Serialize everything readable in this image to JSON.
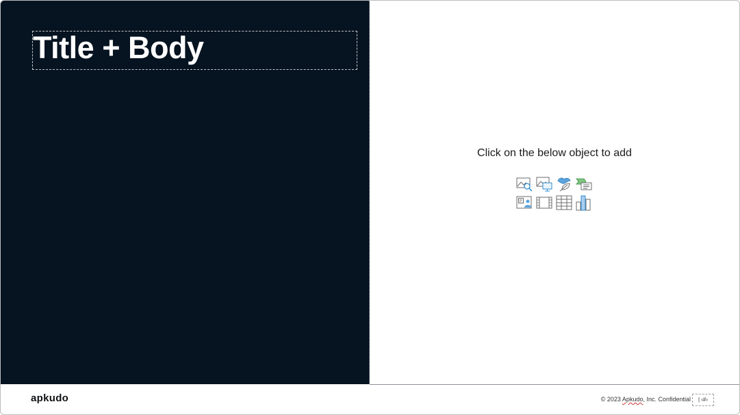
{
  "slide": {
    "title": "Title + Body",
    "placeholder_prompt": "Click on the below object to add",
    "insert_icons": [
      {
        "name": "search-image-icon",
        "label": "Search image"
      },
      {
        "name": "stock-image-icon",
        "label": "Stock images"
      },
      {
        "name": "icons-icon",
        "label": "Icons"
      },
      {
        "name": "smartart-icon",
        "label": "SmartArt"
      },
      {
        "name": "picture-icon",
        "label": "Pictures"
      },
      {
        "name": "video-icon",
        "label": "Video"
      },
      {
        "name": "table-icon",
        "label": "Table"
      },
      {
        "name": "chart-icon",
        "label": "Chart"
      }
    ]
  },
  "footer": {
    "logo_text": "apkudo",
    "copyright_prefix": "© 2023 ",
    "copyright_company": "Apkudo",
    "copyright_suffix": ", Inc. Confidential",
    "slide_number": "| ‹#›"
  },
  "colors": {
    "dark_panel": "#061320",
    "title_text": "#ffffff",
    "background": "#ffffff"
  }
}
